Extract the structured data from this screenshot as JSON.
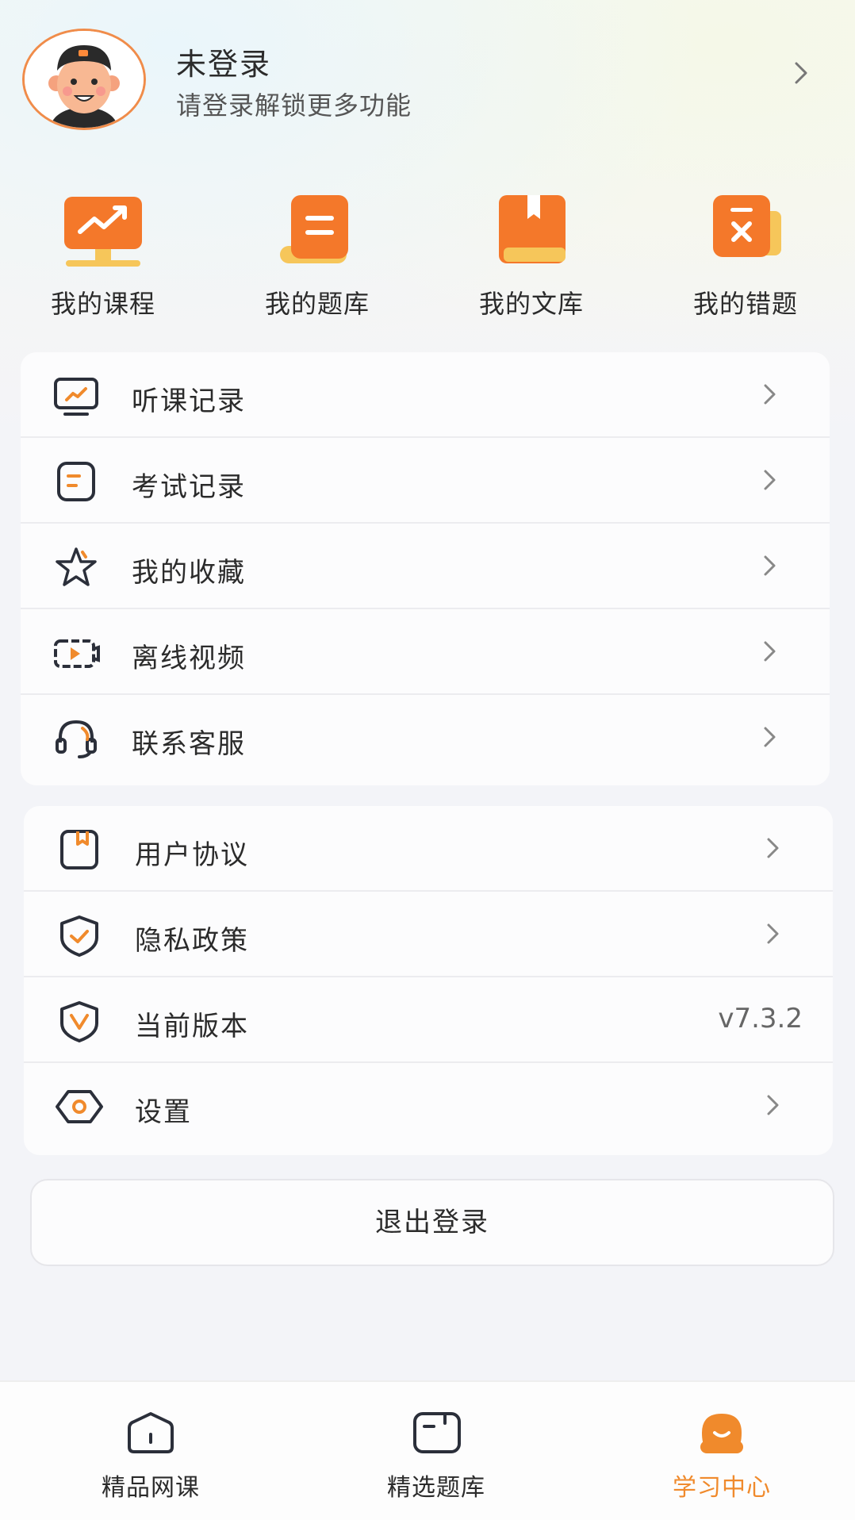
{
  "header": {
    "title": "未登录",
    "subtitle": "请登录解锁更多功能"
  },
  "quick_actions": [
    {
      "label": "我的课程",
      "icon": "course-monitor-icon"
    },
    {
      "label": "我的题库",
      "icon": "question-bank-icon"
    },
    {
      "label": "我的文库",
      "icon": "library-book-icon"
    },
    {
      "label": "我的错题",
      "icon": "wrong-questions-icon"
    }
  ],
  "menu_primary": [
    {
      "label": "听课记录",
      "icon": "lecture-history-icon"
    },
    {
      "label": "考试记录",
      "icon": "exam-record-icon"
    },
    {
      "label": "我的收藏",
      "icon": "star-icon"
    },
    {
      "label": "离线视频",
      "icon": "offline-video-icon"
    },
    {
      "label": "联系客服",
      "icon": "headset-icon"
    }
  ],
  "menu_secondary": [
    {
      "label": "用户协议",
      "icon": "agreement-icon"
    },
    {
      "label": "隐私政策",
      "icon": "privacy-shield-icon"
    },
    {
      "label": "当前版本",
      "icon": "version-icon",
      "value": "v7.3.2"
    },
    {
      "label": "设置",
      "icon": "settings-icon"
    }
  ],
  "logout_label": "退出登录",
  "tabs": [
    {
      "label": "精品网课",
      "icon": "home-courses-icon",
      "active": false
    },
    {
      "label": "精选题库",
      "icon": "question-bank-tab-icon",
      "active": false
    },
    {
      "label": "学习中心",
      "icon": "learning-center-icon",
      "active": true
    }
  ],
  "colors": {
    "accent": "#f08a2c",
    "icon_dark": "#2b2f3a",
    "card_bg": "#fcfcfd",
    "page_bg": "#f3f4f8"
  }
}
